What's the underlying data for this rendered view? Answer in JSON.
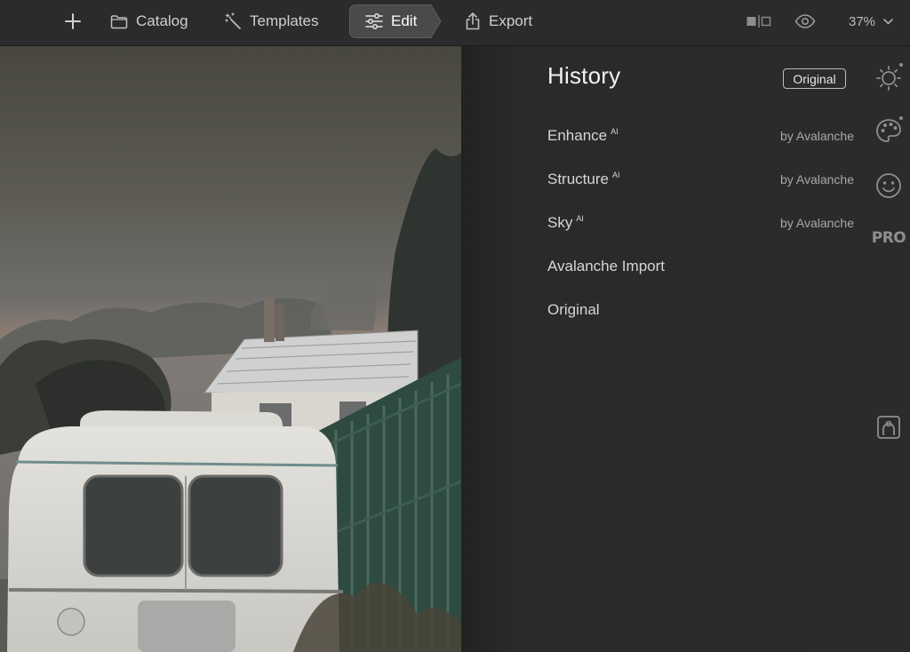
{
  "toolbar": {
    "catalog_label": "Catalog",
    "templates_label": "Templates",
    "edit_label": "Edit",
    "export_label": "Export",
    "zoom_value": "37%"
  },
  "history": {
    "title": "History",
    "original_button": "Original",
    "items": [
      {
        "label": "Enhance",
        "badge": "AI",
        "by": "by Avalanche"
      },
      {
        "label": "Structure",
        "badge": "AI",
        "by": "by Avalanche"
      },
      {
        "label": "Sky",
        "badge": "AI",
        "by": "by Avalanche"
      },
      {
        "label": "Avalanche Import",
        "badge": "",
        "by": ""
      },
      {
        "label": "Original",
        "badge": "",
        "by": ""
      }
    ]
  },
  "rail": {
    "pro_label": "PRO",
    "icons": [
      "sun-icon",
      "palette-icon",
      "smiley-icon",
      "pro-icon",
      "portrait-tool-icon"
    ]
  },
  "colors": {
    "toolbar_bg": "#2b2b2b",
    "panel_bg": "#2b2b2b",
    "active_tab_bg": "#4a4a4a",
    "text": "#d6d6d6",
    "muted_text": "#a8a8a8"
  }
}
